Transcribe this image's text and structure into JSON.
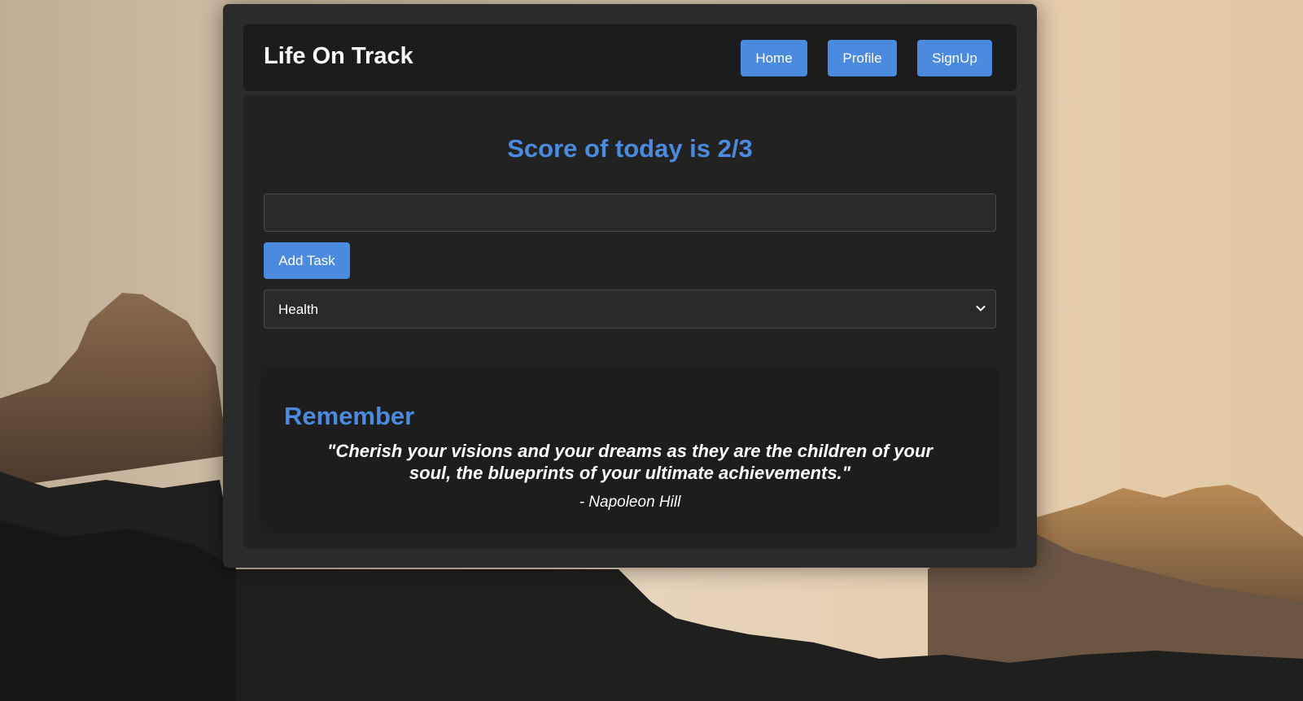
{
  "app": {
    "brand": "Life On Track"
  },
  "nav": {
    "home": "Home",
    "profile": "Profile",
    "signup": "SignUp"
  },
  "score": {
    "title": "Score of today is 2/3"
  },
  "task_form": {
    "input_value": "",
    "input_placeholder": "",
    "add_label": "Add Task",
    "category_selected": "Health"
  },
  "quote": {
    "heading": "Remember",
    "text": "\"Cherish your visions and your dreams as they are the children of your soul, the blueprints of your ultimate achievements.\"",
    "author": "- Napoleon Hill"
  },
  "colors": {
    "accent": "#4a8be0",
    "top_strip": "#b81f1f",
    "card_bg": "#2b2b2b",
    "panel_bg": "#222222",
    "nav_bg": "#1c1c1c"
  },
  "icons": {
    "select_chevron": "chevron-down-icon"
  }
}
